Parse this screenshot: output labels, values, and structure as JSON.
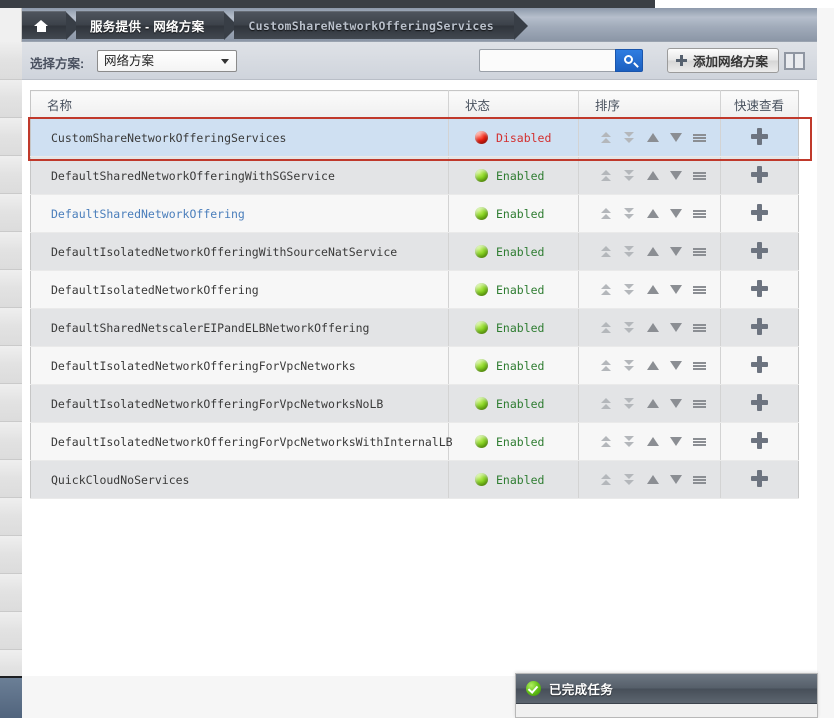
{
  "breadcrumb": {
    "home_icon": "home-icon",
    "items": [
      {
        "label": "服务提供 - 网络方案",
        "current": false
      },
      {
        "label": "CustomShareNetworkOfferingServices",
        "current": true
      }
    ]
  },
  "toolbar": {
    "select_label": "选择方案:",
    "select_value": "网络方案",
    "search_value": "",
    "search_placeholder": "",
    "search_icon": "search-icon",
    "add_button_label": "添加网络方案",
    "add_icon": "plus-icon",
    "columns_toggle_icon": "two-column-layout-icon"
  },
  "table": {
    "columns": [
      "名称",
      "状态",
      "排序",
      "快速查看"
    ],
    "sort_icons": [
      "move-to-top-icon",
      "move-to-bottom-icon",
      "move-up-icon",
      "move-down-icon",
      "reorder-handle-icon"
    ],
    "quickview_icon": "plus-icon",
    "rows": [
      {
        "name": "CustomShareNetworkOfferingServices",
        "status": "Disabled",
        "state": "disabled",
        "selected": true,
        "link": false
      },
      {
        "name": "DefaultSharedNetworkOfferingWithSGService",
        "status": "Enabled",
        "state": "enabled",
        "selected": false,
        "link": false
      },
      {
        "name": "DefaultSharedNetworkOffering",
        "status": "Enabled",
        "state": "enabled",
        "selected": false,
        "link": true
      },
      {
        "name": "DefaultIsolatedNetworkOfferingWithSourceNatService",
        "status": "Enabled",
        "state": "enabled",
        "selected": false,
        "link": false
      },
      {
        "name": "DefaultIsolatedNetworkOffering",
        "status": "Enabled",
        "state": "enabled",
        "selected": false,
        "link": false
      },
      {
        "name": "DefaultSharedNetscalerEIPandELBNetworkOffering",
        "status": "Enabled",
        "state": "enabled",
        "selected": false,
        "link": false
      },
      {
        "name": "DefaultIsolatedNetworkOfferingForVpcNetworks",
        "status": "Enabled",
        "state": "enabled",
        "selected": false,
        "link": false
      },
      {
        "name": "DefaultIsolatedNetworkOfferingForVpcNetworksNoLB",
        "status": "Enabled",
        "state": "enabled",
        "selected": false,
        "link": false
      },
      {
        "name": "DefaultIsolatedNetworkOfferingForVpcNetworksWithInternalLB",
        "status": "Enabled",
        "state": "enabled",
        "selected": false,
        "link": false
      },
      {
        "name": "QuickCloudNoServices",
        "status": "Enabled",
        "state": "enabled",
        "selected": false,
        "link": false
      }
    ]
  },
  "notification": {
    "icon": "success-check-icon",
    "title": "已完成任务"
  },
  "colors": {
    "accent_blue": "#2f7de1",
    "enabled_green": "#2f7d32",
    "disabled_red": "#d32f2f",
    "selected_row": "#cfe0f2",
    "annotation_red": "#c0392b"
  }
}
